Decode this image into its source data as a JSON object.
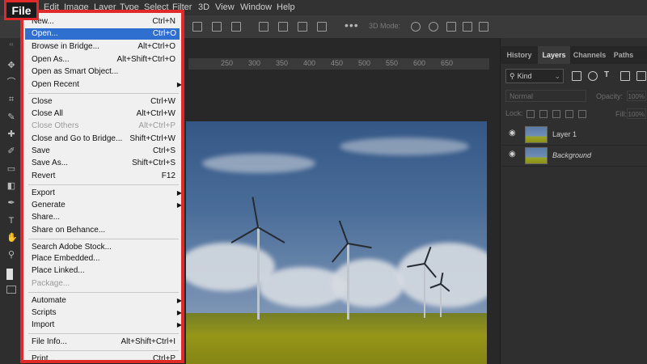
{
  "menubar": {
    "items": [
      "Edit",
      "Image",
      "Layer",
      "Type",
      "Select",
      "Filter",
      "3D",
      "View",
      "Window",
      "Help"
    ]
  },
  "file_label": "File",
  "options_bar": {
    "three_d_mode": "3D Mode:"
  },
  "ruler": {
    "ticks": [
      "250",
      "300",
      "350",
      "400",
      "450",
      "500",
      "550",
      "600",
      "650"
    ]
  },
  "file_menu": {
    "items": [
      {
        "label": "New...",
        "shortcut": "Ctrl+N"
      },
      {
        "label": "Open...",
        "shortcut": "Ctrl+O"
      },
      {
        "label": "Browse in Bridge...",
        "shortcut": "Alt+Ctrl+O"
      },
      {
        "label": "Open As...",
        "shortcut": "Alt+Shift+Ctrl+O"
      },
      {
        "label": "Open as Smart Object...",
        "shortcut": ""
      },
      {
        "label": "Open Recent",
        "shortcut": ""
      },
      {
        "label": "Close",
        "shortcut": "Ctrl+W"
      },
      {
        "label": "Close All",
        "shortcut": "Alt+Ctrl+W"
      },
      {
        "label": "Close Others",
        "shortcut": "Alt+Ctrl+P"
      },
      {
        "label": "Close and Go to Bridge...",
        "shortcut": "Shift+Ctrl+W"
      },
      {
        "label": "Save",
        "shortcut": "Ctrl+S"
      },
      {
        "label": "Save As...",
        "shortcut": "Shift+Ctrl+S"
      },
      {
        "label": "Revert",
        "shortcut": "F12"
      },
      {
        "label": "Export",
        "shortcut": ""
      },
      {
        "label": "Generate",
        "shortcut": ""
      },
      {
        "label": "Share...",
        "shortcut": ""
      },
      {
        "label": "Share on Behance...",
        "shortcut": ""
      },
      {
        "label": "Search Adobe Stock...",
        "shortcut": ""
      },
      {
        "label": "Place Embedded...",
        "shortcut": ""
      },
      {
        "label": "Place Linked...",
        "shortcut": ""
      },
      {
        "label": "Package...",
        "shortcut": ""
      },
      {
        "label": "Automate",
        "shortcut": ""
      },
      {
        "label": "Scripts",
        "shortcut": ""
      },
      {
        "label": "Import",
        "shortcut": ""
      },
      {
        "label": "File Info...",
        "shortcut": "Alt+Shift+Ctrl+I"
      },
      {
        "label": "Print...",
        "shortcut": "Ctrl+P"
      }
    ]
  },
  "panel": {
    "tabs": [
      "History",
      "Layers",
      "Channels",
      "Paths"
    ],
    "active_tab": "Layers",
    "filter_kind": "Kind",
    "blend_mode": "Normal",
    "opacity_label": "Opacity:",
    "opacity_value": "100%",
    "lock_label": "Lock:",
    "fill_label": "Fill:",
    "fill_value": "100%",
    "layers": [
      "Layer 1",
      "Background"
    ]
  },
  "colors": {
    "highlight": "#2f6fd0",
    "callout_border": "#e02a2a",
    "menu_bg": "#f0f0f0",
    "app_bg": "#282828"
  }
}
